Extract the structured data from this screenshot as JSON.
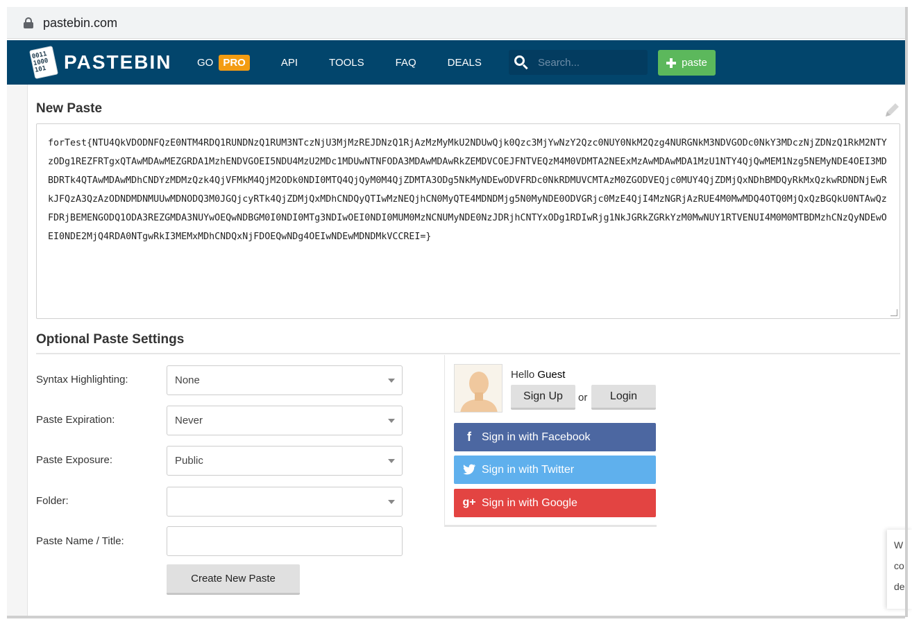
{
  "browser": {
    "url": "pastebin.com"
  },
  "header": {
    "logo_text": "PASTEBIN",
    "logo_bits": "0011\n1000\n101",
    "nav": {
      "go_label": "GO",
      "pro_badge": "PRO",
      "api": "API",
      "tools": "TOOLS",
      "faq": "FAQ",
      "deals": "DEALS"
    },
    "search_placeholder": "Search...",
    "paste_button": "paste"
  },
  "main": {
    "title": "New Paste",
    "paste_content": "forTest{NTU4QkVDODNFQzE0NTM4RDQ1RUNDNzQ1RUM3NTczNjU3MjMzREJDNzQ1RjAzMzMyMkU2NDUwQjk0Qzc3MjYwNzY2Qzc0NUY0NkM2Qzg4NURGNkM3NDVGODc0NkY3MDczNjZDNzQ1RkM2NTYzODg1REZFRTgxQTAwMDAwMEZGRDA1MzhENDVGOEI5NDU4MzU2MDc1MDUwNTNFODA3MDAwMDAwRkZEMDVCOEJFNTVEQzM4M0VDMTA2NEExMzAwMDAwMDA1MzU1NTY4QjQwMEM1Nzg5NEMyNDE4OEI3MDBDRTk4QTAwMDAwMDhCNDYzMDMzQzk4QjVFMkM4QjM2ODk0NDI0MTQ4QjQyM0M4QjZDMTA3ODg5NkMyNDEwODVFRDc0NkRDMUVCMTAzM0ZGODVEQjc0MUY4QjZDMjQxNDhBMDQyRkMxQzkwRDNDNjEwRkJFQzA3QzAzODNDMDNMUUwMDNODQ3M0JGQjcyRTk4QjZDMjQxMDhCNDQyQTIwMzNEQjhCN0MyQTE4MDNDMjg5N0MyNDE0ODVGRjc0MzE4QjI4MzNGRjAzRUE4M0MwMDQ4OTQ0MjQxQzBGQkU0NTAwQzFDRjBEMENGODQ1ODA3REZGMDA3NUYwOEQwNDBGM0I0NDI0MTg3NDIwOEI0NDI0MUM0MzNCNUMyNDE0NzJDRjhCNTYxODg1RDIwRjg1NkJGRkZGRkYzM0MwNUY1RTVENUI4M0M0MTBDMzhCNzQyNDEwOEI0NDE2MjQ4RDA0NTgwRkI3MEMxMDhCNDQxNjFDOEQwNDg4OEIwNDEwMDNDMkVCCREI=}",
    "settings_title": "Optional Paste Settings",
    "settings": {
      "syntax_label": "Syntax Highlighting:",
      "syntax_value": "None",
      "expiration_label": "Paste Expiration:",
      "expiration_value": "Never",
      "exposure_label": "Paste Exposure:",
      "exposure_value": "Public",
      "folder_label": "Folder:",
      "folder_value": "",
      "name_label": "Paste Name / Title:",
      "name_value": "",
      "create_button": "Create New Paste"
    }
  },
  "login": {
    "hello": "Hello",
    "guest": "Guest",
    "sign_up": "Sign Up",
    "or": "or",
    "login": "Login",
    "facebook": "Sign in with Facebook",
    "twitter": "Sign in with Twitter",
    "google": "Sign in with Google",
    "colors": {
      "facebook": "#4c67a1",
      "twitter": "#5fb0ed",
      "google": "#e34442",
      "header": "#02456c",
      "pro": "#f39c12",
      "paste": "#5cb85c"
    }
  },
  "edge_toast": {
    "line1": "W",
    "line2": "co",
    "line3": "de"
  }
}
